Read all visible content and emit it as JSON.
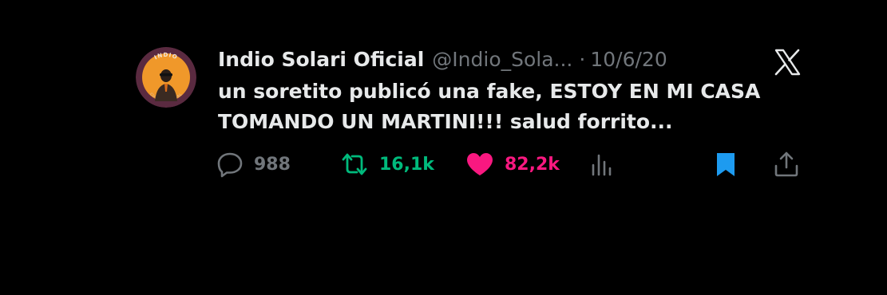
{
  "tweet": {
    "display_name": "Indio Solari Oficial",
    "handle": "@Indio_Sola...",
    "separator": "·",
    "date": "10/6/20",
    "avatar_text_top": "INDIO",
    "avatar_text_bottom": "CUENTA OFICIAL",
    "text_lines": [
      "un soretito publicó una fake, ESTOY EN MI CASA",
      "TOMANDO UN MARTINI!!! salud forrito..."
    ]
  },
  "actions": {
    "reply": {
      "icon": "reply-icon",
      "count": "988",
      "color": "#71767b"
    },
    "retweet": {
      "icon": "retweet-icon",
      "count": "16,1k",
      "color": "#00ba7c"
    },
    "like": {
      "icon": "heart-icon",
      "count": "82,2k",
      "color": "#f91880"
    },
    "views": {
      "icon": "views-icon",
      "color": "#71767b"
    },
    "bookmark": {
      "icon": "bookmark-icon",
      "color": "#1d9bf0"
    },
    "share": {
      "icon": "share-icon",
      "color": "#71767b"
    }
  },
  "colors": {
    "background": "#000000",
    "text": "#e7e9ea",
    "muted": "#71767b"
  }
}
